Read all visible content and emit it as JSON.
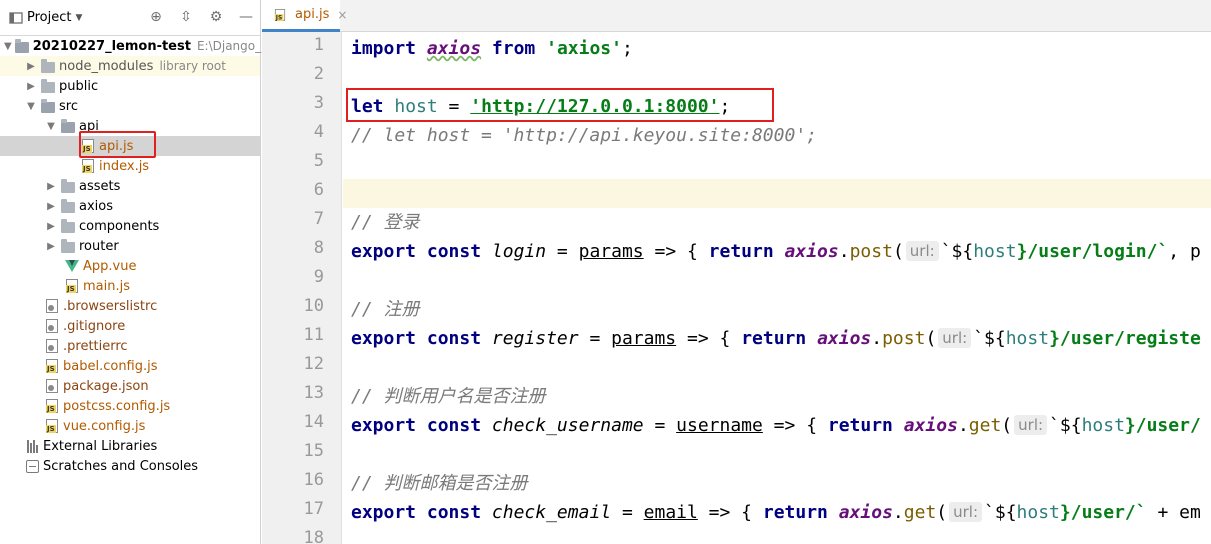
{
  "project_panel": {
    "title": "Project",
    "tree": [
      {
        "label": "20210227_lemon-test",
        "extra": "E:\\Django_pro",
        "type": "root"
      },
      {
        "label": "node_modules",
        "extra": "library root",
        "type": "folder"
      },
      {
        "label": "public",
        "type": "folder"
      },
      {
        "label": "src",
        "type": "folder"
      },
      {
        "label": "api",
        "type": "folder"
      },
      {
        "label": "api.js",
        "type": "js"
      },
      {
        "label": "index.js",
        "type": "js"
      },
      {
        "label": "assets",
        "type": "folder"
      },
      {
        "label": "axios",
        "type": "folder"
      },
      {
        "label": "components",
        "type": "folder"
      },
      {
        "label": "router",
        "type": "folder"
      },
      {
        "label": "App.vue",
        "type": "vue"
      },
      {
        "label": "main.js",
        "type": "js"
      },
      {
        "label": ".browserslistrc",
        "type": "cfg"
      },
      {
        "label": ".gitignore",
        "type": "cfg"
      },
      {
        "label": ".prettierrc",
        "type": "cfg"
      },
      {
        "label": "babel.config.js",
        "type": "js"
      },
      {
        "label": "package.json",
        "type": "cfg"
      },
      {
        "label": "postcss.config.js",
        "type": "js"
      },
      {
        "label": "vue.config.js",
        "type": "js"
      },
      {
        "label": "External Libraries",
        "type": "libs"
      },
      {
        "label": "Scratches and Consoles",
        "type": "scratch"
      }
    ]
  },
  "editor": {
    "tab_label": "api.js",
    "tab_close": "×",
    "line_numbers": [
      "1",
      "2",
      "3",
      "4",
      "5",
      "6",
      "7",
      "8",
      "9",
      "10",
      "11",
      "12",
      "13",
      "14",
      "15",
      "16",
      "17",
      "18"
    ],
    "lines": {
      "l1": {
        "import": "import",
        "axios": "axios",
        "from": "from",
        "str": "'axios'",
        "semi": ";"
      },
      "l3": {
        "let": "let",
        "host": "host",
        "eq": " = ",
        "str": "'http://127.0.0.1:8000'",
        "semi": ";"
      },
      "l4": {
        "text": "// let host = 'http://api.keyou.site:8000';"
      },
      "l7": {
        "text": "// 登录"
      },
      "l8": {
        "export": "export",
        "const": "const",
        "name": "login",
        "eq": " = ",
        "param": "params",
        "arrow": " => { ",
        "ret": "return",
        "axios": "axios",
        "method": "post",
        "hint": "url:",
        "tpl_a": "`${",
        "host": "host",
        "tpl_b": "}/user/login/`",
        "tail": ", p"
      },
      "l10": {
        "text": "// 注册"
      },
      "l11": {
        "export": "export",
        "const": "const",
        "name": "register",
        "eq": " = ",
        "param": "params",
        "arrow": " => { ",
        "ret": "return",
        "axios": "axios",
        "method": "post",
        "hint": "url:",
        "tpl_a": "`${",
        "host": "host",
        "tpl_b": "}/user/registe"
      },
      "l13": {
        "text": "// 判断用户名是否注册"
      },
      "l14": {
        "export": "export",
        "const": "const",
        "name": "check_username",
        "eq": " = ",
        "param": "username",
        "arrow": " => { ",
        "ret": "return",
        "axios": "axios",
        "method": "get",
        "hint": "url:",
        "tpl_a": "`${",
        "host": "host",
        "tpl_b": "}/user/"
      },
      "l16": {
        "text": "// 判断邮箱是否注册"
      },
      "l17": {
        "export": "export",
        "const": "const",
        "name": "check_email",
        "eq": " = ",
        "param": "email",
        "arrow": " => { ",
        "ret": "return",
        "axios": "axios",
        "method": "get",
        "hint": "url:",
        "tpl_a": "`${",
        "host": "host",
        "tpl_b": "}/user/`",
        "tail": " + em"
      }
    }
  }
}
